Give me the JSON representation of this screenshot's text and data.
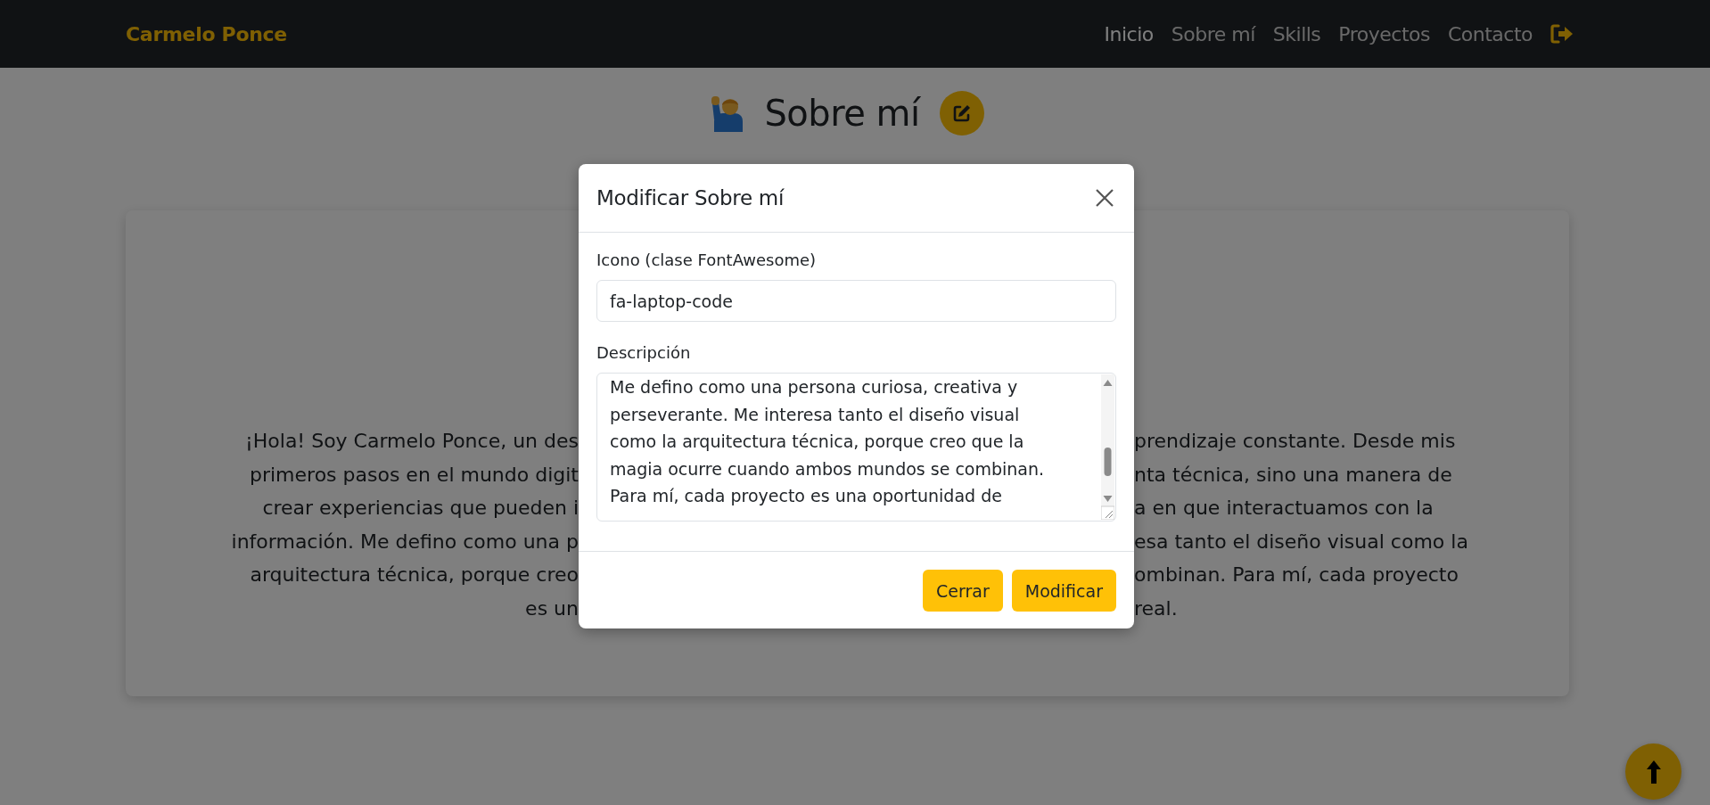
{
  "navbar": {
    "brand": "Carmelo Ponce",
    "links": [
      {
        "label": "Inicio",
        "selected": true
      },
      {
        "label": "Sobre mí",
        "selected": false
      },
      {
        "label": "Skills",
        "selected": false
      },
      {
        "label": "Proyectos",
        "selected": false
      },
      {
        "label": "Contacto",
        "selected": false
      }
    ]
  },
  "section": {
    "title": "Sobre mí",
    "paragraph_lines": [
      {
        "left": "¡Hola! Soy Carmelo Ponce, un des",
        "right": "prendizaje constante. Desde mis"
      },
      {
        "left": "primeros pasos en el mundo digit",
        "right": "nta técnica, sino una manera de"
      },
      {
        "left": "crear experiencias que pueden i",
        "right": "a en que interactuamos con la"
      },
      {
        "left": "información. Me defino como una p",
        "right": "esa tanto el diseño visual como la"
      },
      {
        "left": "arquitectura técnica, porque creo",
        "right": "ombinan. Para mí, cada proyecto"
      },
      {
        "left": "es un",
        "right": "real."
      }
    ]
  },
  "modal": {
    "title": "Modificar Sobre mí",
    "fields": [
      {
        "kind": "input",
        "label": "Icono (clase FontAwesome)",
        "value": "fa-laptop-code"
      },
      {
        "kind": "textarea",
        "label": "Descripción",
        "lines": [
          "Me defino como una persona curiosa, creativa y",
          "perseverante. Me interesa tanto el diseño visual",
          "como la arquitectura técnica, porque creo que la",
          "magia ocurre cuando ambos mundos se combinan.",
          "Para mí, cada proyecto es una oportunidad de"
        ]
      }
    ],
    "buttons": [
      "Cerrar",
      "Modificar"
    ]
  }
}
